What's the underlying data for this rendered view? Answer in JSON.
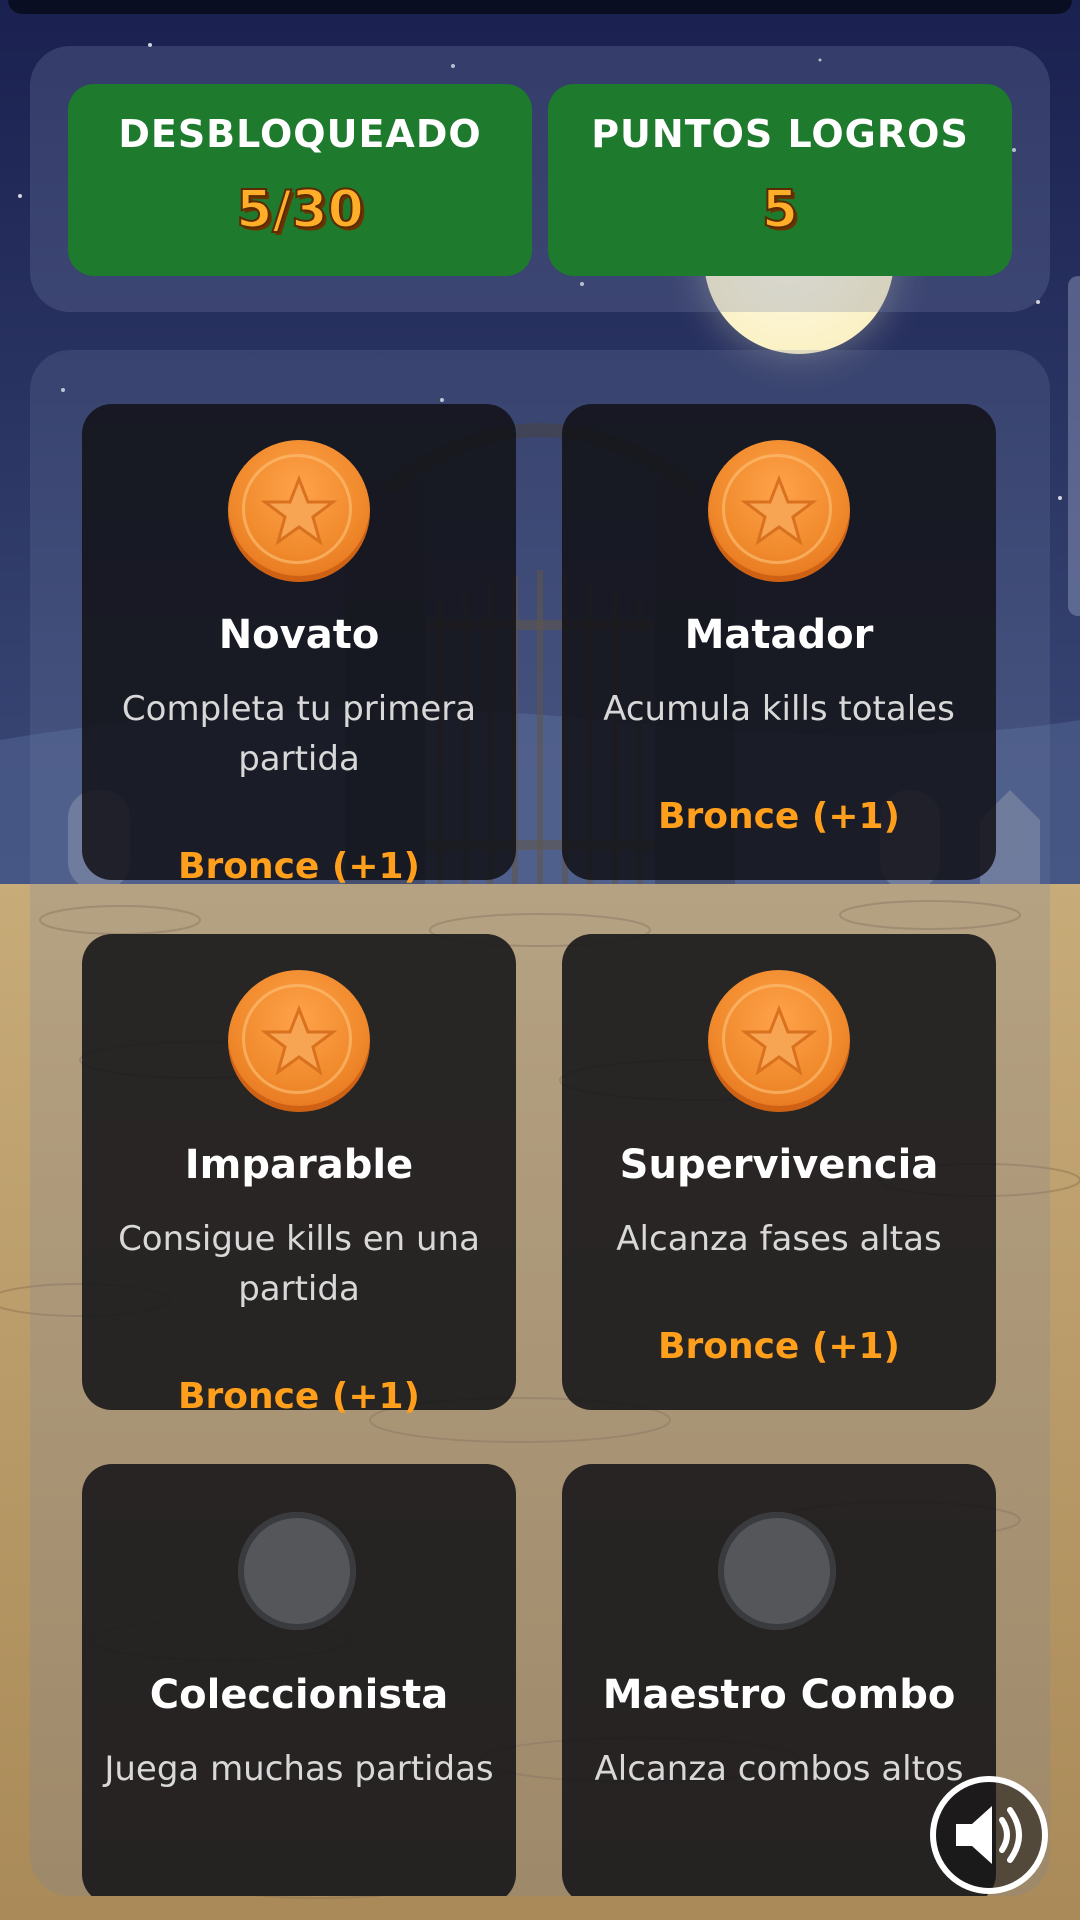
{
  "colors": {
    "sky_top": "#1b2350",
    "ground": "#b89a6a",
    "stat_green": "#1e7a2c",
    "value_orange": "#ffae2a",
    "tier_orange": "#ff9f1c"
  },
  "stats": {
    "unlocked_label": "DESBLOQUEADO",
    "unlocked_value": "5/30",
    "points_label": "PUNTOS LOGROS",
    "points_value": "5"
  },
  "achievements": [
    {
      "title": "Novato",
      "desc": "Completa tu primera partida",
      "tier": "Bronce (+1)",
      "unlocked": true,
      "icon": "bronze-medal-icon"
    },
    {
      "title": "Matador",
      "desc": "Acumula kills totales",
      "tier": "Bronce (+1)",
      "unlocked": true,
      "icon": "bronze-medal-icon"
    },
    {
      "title": "Imparable",
      "desc": "Consigue kills en una partida",
      "tier": "Bronce (+1)",
      "unlocked": true,
      "icon": "bronze-medal-icon"
    },
    {
      "title": "Supervivencia",
      "desc": "Alcanza fases altas",
      "tier": "Bronce (+1)",
      "unlocked": true,
      "icon": "bronze-medal-icon"
    },
    {
      "title": "Coleccionista",
      "desc": "Juega muchas partidas",
      "unlocked": false,
      "icon": "locked-medal-icon"
    },
    {
      "title": "Maestro Combo",
      "desc": "Alcanza combos altos",
      "unlocked": false,
      "icon": "locked-medal-icon"
    }
  ],
  "controls": {
    "sound_icon": "speaker-icon"
  }
}
